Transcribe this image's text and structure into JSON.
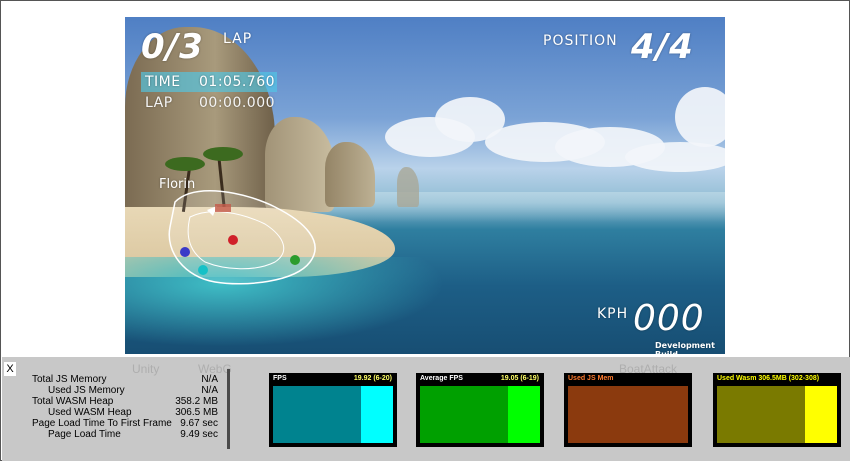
{
  "hud": {
    "lap_count": "0/3",
    "lap_label": "LAP",
    "time_label": "TIME",
    "time_value": "01:05.760",
    "lap_time_label": "LAP",
    "lap_time_value": "00:00.000",
    "position_label": "POSITION",
    "position_value": "4/4",
    "kph_label": "KPH",
    "kph_value": "000",
    "dev_build": "Development Build",
    "player_name": "Florin"
  },
  "watermarks": {
    "unity": "Unity",
    "webgl": "WebG",
    "boatattack": "BoatAttack"
  },
  "stats": {
    "close_label": "X",
    "memory": [
      {
        "label": "Total JS Memory",
        "value": "N/A",
        "indent": false
      },
      {
        "label": "Used JS Memory",
        "value": "N/A",
        "indent": true
      },
      {
        "label": "Total WASM Heap",
        "value": "358.2 MB",
        "indent": false
      },
      {
        "label": "Used WASM Heap",
        "value": "306.5 MB",
        "indent": true
      },
      {
        "label": "Page Load Time To First Frame",
        "value": "9.67 sec",
        "indent": false
      },
      {
        "label": "Page Load Time",
        "value": "9.49 sec",
        "indent": true
      }
    ],
    "graphs": [
      {
        "title": "FPS",
        "value": "19.92 (6-20)",
        "bg": "#00838f",
        "fill": "#00ffff",
        "fill_fraction": 0.27,
        "title_color": "#ffffff"
      },
      {
        "title": "Average FPS",
        "value": "19.05 (6-19)",
        "bg": "#00a000",
        "fill": "#00ff00",
        "fill_fraction": 0.27,
        "title_color": "#ffffff"
      },
      {
        "title": "Used JS Mem",
        "value": "",
        "bg": "#8b3a0e",
        "fill": "#8b3a0e",
        "fill_fraction": 0,
        "title_color": "#ff7b2f"
      },
      {
        "title": "Used Wasm 306.5MB (302-308)",
        "value": "",
        "bg": "#7a7a00",
        "fill": "#ffff00",
        "fill_fraction": 0.27,
        "title_color": "#ffff00"
      }
    ]
  }
}
